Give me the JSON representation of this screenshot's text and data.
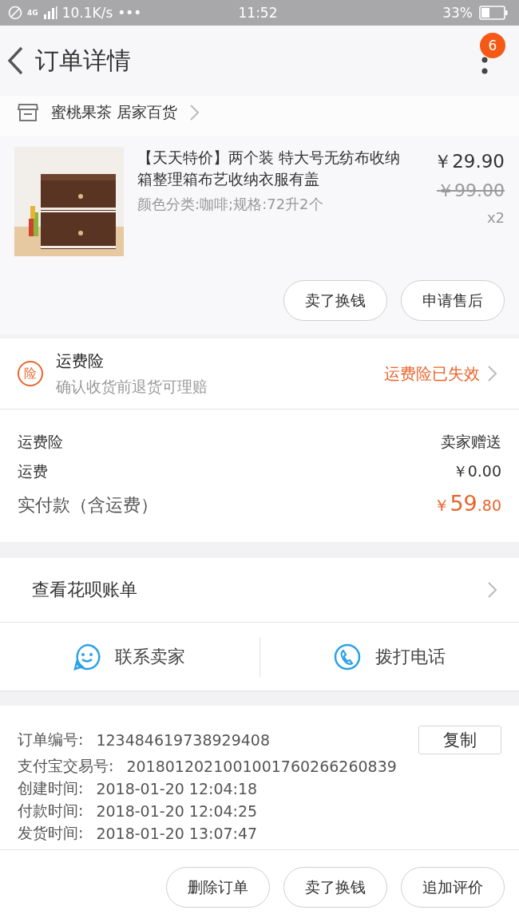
{
  "status_bar": {
    "network": "4G",
    "speed": "10.1K/s",
    "more": "•••",
    "time": "11:52",
    "battery": "33%"
  },
  "header": {
    "title": "订单详情",
    "badge": "6"
  },
  "shop": {
    "name": "蜜桃果茶 居家百货"
  },
  "product": {
    "title": "【天天特价】两个装 特大号无纺布收纳箱整理箱布艺收纳衣服有盖",
    "spec": "颜色分类:咖啡;规格:72升2个",
    "price": "￥29.90",
    "original_price": "￥99.00",
    "quantity": "x2",
    "image": {
      "kind": "picture"
    },
    "buttons": [
      "卖了换钱",
      "申请售后"
    ]
  },
  "insurance": {
    "icon_text": "险",
    "title": "运费险",
    "subtitle": "确认收货前退货可理赔",
    "status": "运费险已失效"
  },
  "fees": [
    {
      "label": "运费险",
      "value": "卖家赠送",
      "kind": "normal"
    },
    {
      "label": "运费",
      "value": "￥0.00",
      "kind": "normal"
    },
    {
      "label": "实付款（含运费）",
      "value": "￥59.80",
      "kind": "total"
    }
  ],
  "huabei": {
    "label": "查看花呗账单"
  },
  "contact": [
    {
      "label": "联系卖家",
      "kind": "chat"
    },
    {
      "label": "拨打电话",
      "kind": "phone"
    }
  ],
  "info": [
    {
      "label": "订单编号:",
      "value": "123484619738929408",
      "copy": "复制"
    },
    {
      "label": "支付宝交易号:",
      "value": "2018012021001001760266260839"
    },
    {
      "label": "创建时间:",
      "value": "2018-01-20 12:04:18"
    },
    {
      "label": "付款时间:",
      "value": "2018-01-20 12:04:25"
    },
    {
      "label": "发货时间:",
      "value": "2018-01-20 13:07:47"
    }
  ],
  "actions": [
    "删除订单",
    "卖了换钱",
    "追加评价"
  ]
}
